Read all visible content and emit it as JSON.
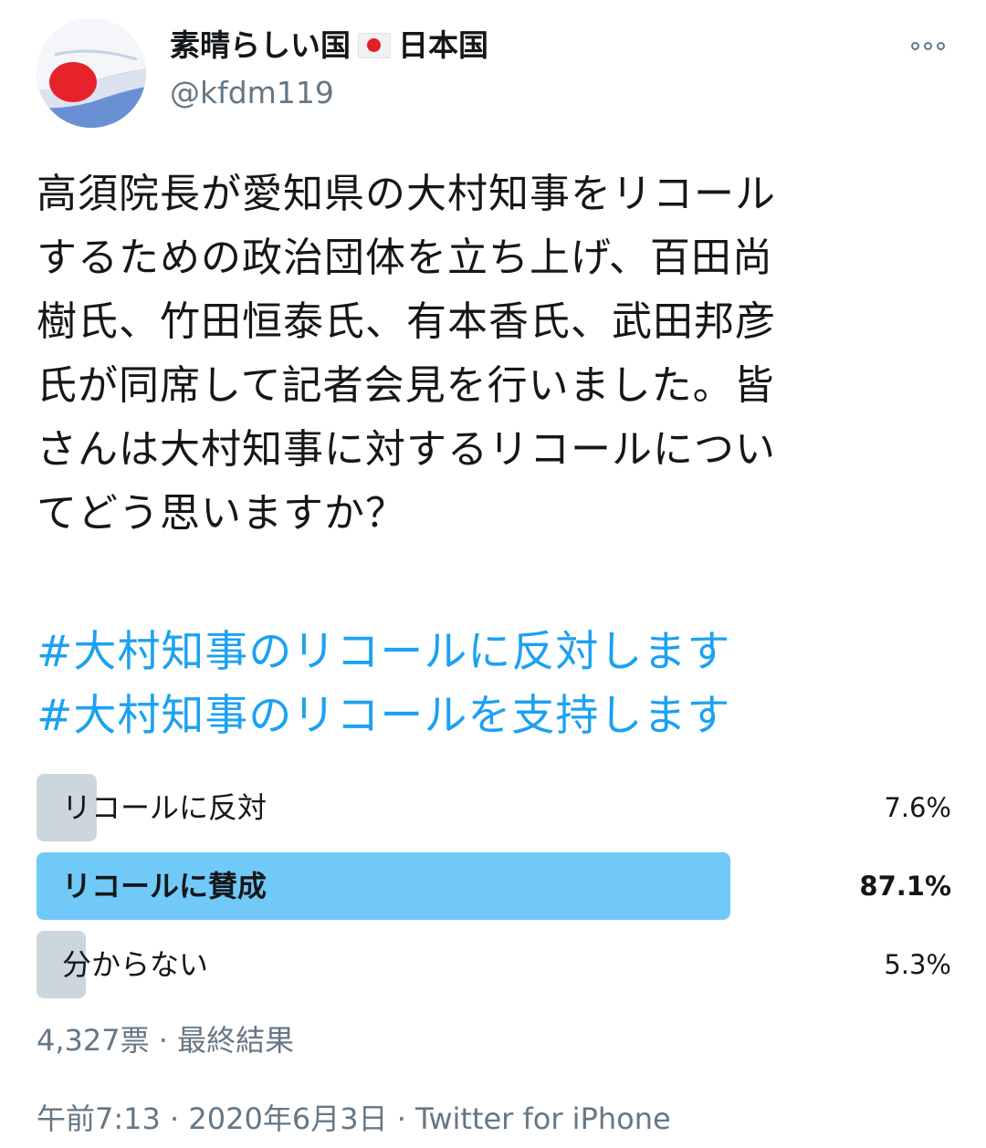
{
  "user": {
    "display_name": "素晴らしい国",
    "display_name_suffix": "日本国",
    "flag_icon": "japan-flag-icon",
    "handle": "@kfdm119"
  },
  "tweet": {
    "text_lines": [
      "高須院長が愛知県の大村知事をリコール",
      "するための政治団体を立ち上げ、百田尚",
      "樹氏、竹田恒泰氏、有本香氏、武田邦彦",
      "氏が同席して記者会見を行いました。皆",
      "さんは大村知事に対するリコールについ",
      "てどう思いますか？"
    ],
    "hashtags": [
      "#大村知事のリコールに反対します",
      "#大村知事のリコールを支持します"
    ]
  },
  "poll": {
    "options": [
      {
        "label": "リコールに反対",
        "percent": "7.6%",
        "fraction": 0.076,
        "winner": false
      },
      {
        "label": "リコールに賛成",
        "percent": "87.1%",
        "fraction": 0.871,
        "winner": true
      },
      {
        "label": "分からない",
        "percent": "5.3%",
        "fraction": 0.053,
        "winner": false
      }
    ],
    "votes": "4,327票",
    "separator": "·",
    "status": "最終結果"
  },
  "meta": {
    "time": "午前7:13",
    "separator": "·",
    "date": "2020年6月3日",
    "source": "Twitter for iPhone"
  },
  "colors": {
    "link": "#1da1f2",
    "secondary_text": "#657786",
    "poll_bar": "#ccd6dd",
    "poll_bar_winner": "#71c9f8"
  }
}
